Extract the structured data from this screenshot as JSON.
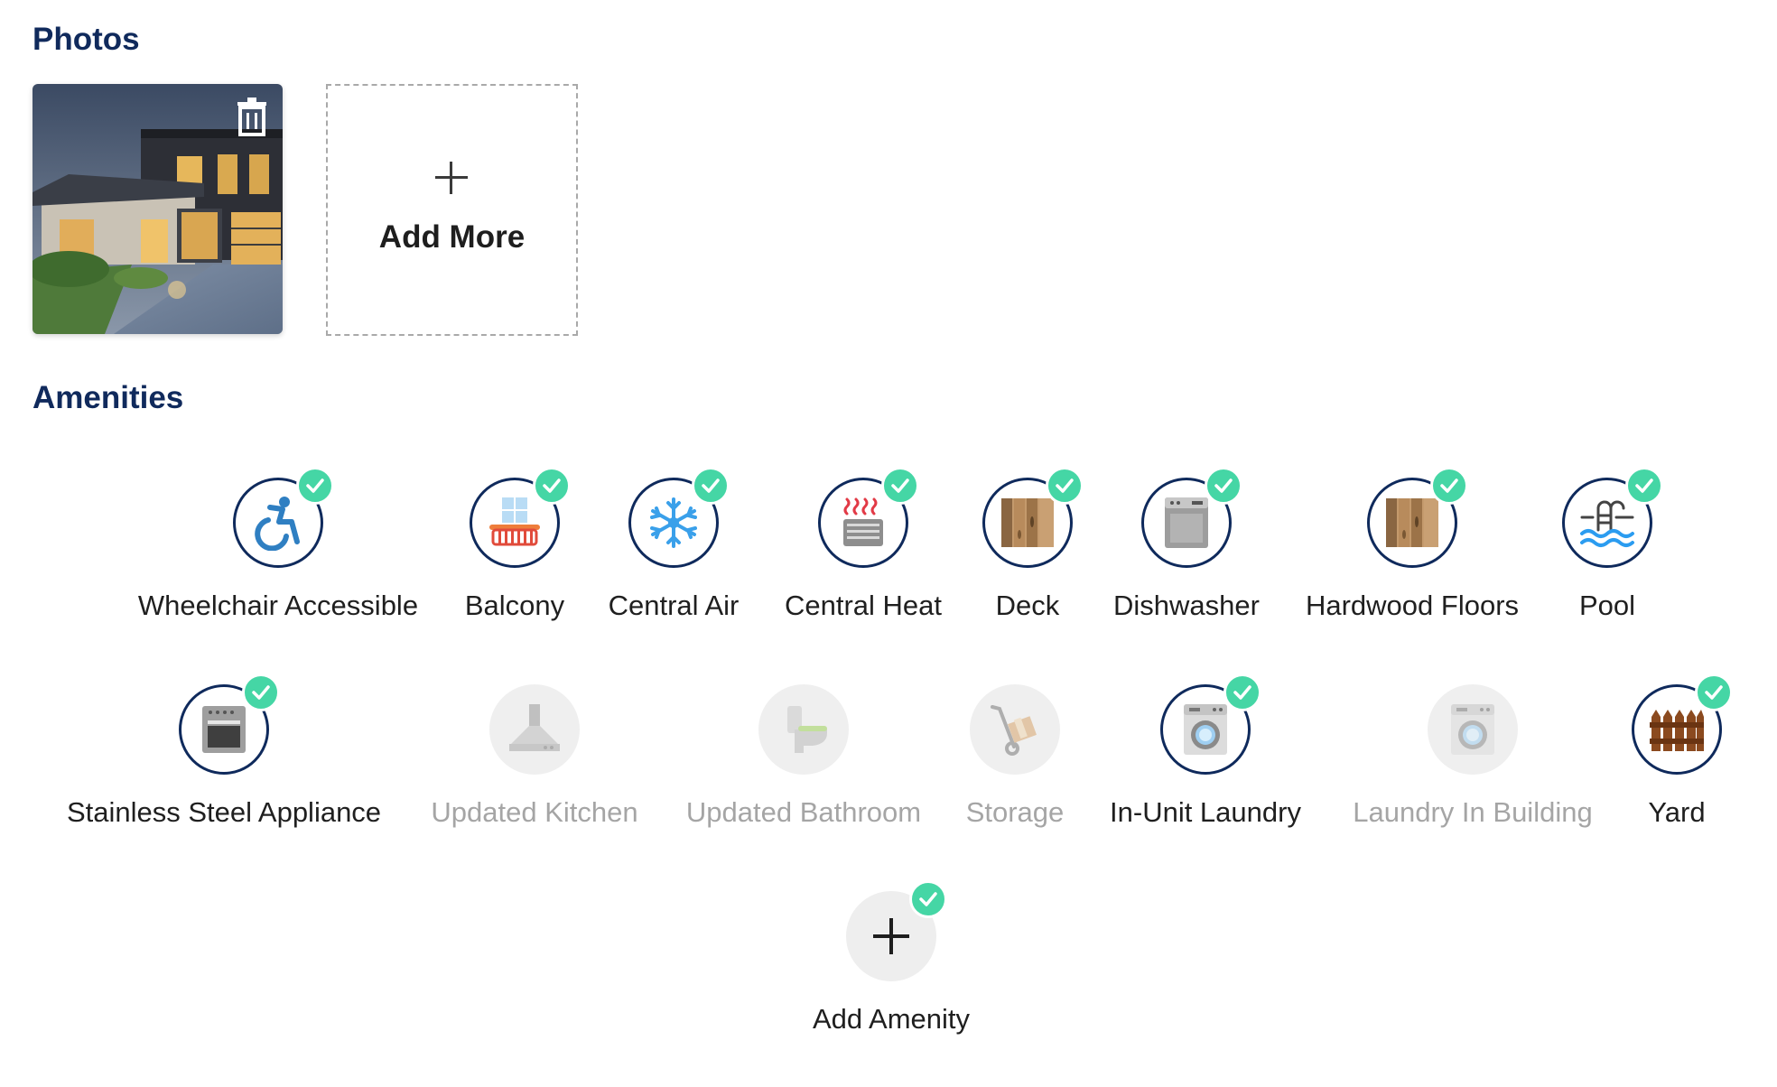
{
  "photos_section": {
    "title": "Photos",
    "add_more_label": "Add More"
  },
  "amenities_section": {
    "title": "Amenities",
    "items": [
      {
        "label": "Wheelchair Accessible",
        "selected": true,
        "icon": "wheelchair-icon"
      },
      {
        "label": "Balcony",
        "selected": true,
        "icon": "balcony-icon"
      },
      {
        "label": "Central Air",
        "selected": true,
        "icon": "snowflake-icon"
      },
      {
        "label": "Central Heat",
        "selected": true,
        "icon": "heater-icon"
      },
      {
        "label": "Deck",
        "selected": true,
        "icon": "wood-deck-icon"
      },
      {
        "label": "Dishwasher",
        "selected": true,
        "icon": "dishwasher-icon"
      },
      {
        "label": "Hardwood Floors",
        "selected": true,
        "icon": "hardwood-icon"
      },
      {
        "label": "Pool",
        "selected": true,
        "icon": "pool-icon"
      },
      {
        "label": "Stainless Steel Appliance",
        "selected": true,
        "icon": "oven-icon"
      },
      {
        "label": "Updated Kitchen",
        "selected": false,
        "icon": "range-hood-icon"
      },
      {
        "label": "Updated Bathroom",
        "selected": false,
        "icon": "toilet-icon"
      },
      {
        "label": "Storage",
        "selected": false,
        "icon": "hand-truck-icon"
      },
      {
        "label": "In-Unit Laundry",
        "selected": true,
        "icon": "washing-machine-icon"
      },
      {
        "label": "Laundry In Building",
        "selected": false,
        "icon": "washing-machine-icon"
      },
      {
        "label": "Yard",
        "selected": true,
        "icon": "fence-icon"
      }
    ],
    "add_label": "Add Amenity"
  },
  "colors": {
    "heading": "#102a5c",
    "circle_border": "#0f2a5c",
    "check_badge": "#45d6a5",
    "disabled_text": "#a5a5a5",
    "disabled_circle": "#efefef"
  }
}
